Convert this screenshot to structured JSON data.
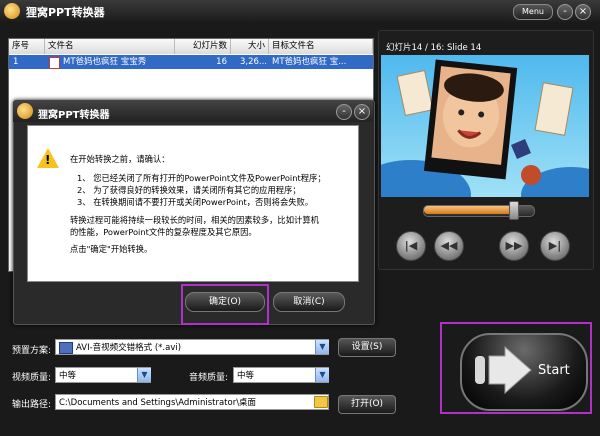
{
  "window": {
    "title": "狸窝PPT转换器",
    "menu_label": "Menu",
    "minimize": "-",
    "close": "×"
  },
  "list": {
    "headers": [
      "序号",
      "文件名",
      "幻灯片数",
      "大小",
      "目标文件名"
    ],
    "rows": [
      {
        "index": "1",
        "filename": "MT爸妈也疯狂 宝宝秀",
        "slides": "16",
        "size": "3,26...",
        "target": "MT爸妈也疯狂 宝..."
      }
    ]
  },
  "preview": {
    "label": "幻灯片14 / 16: Slide 14",
    "progress": 0.82
  },
  "dialog": {
    "title": "狸窝PPT转换器",
    "intro": "在开始转换之前，请确认：",
    "items": [
      "1、  您已经关闭了所有打开的PowerPoint文件及PowerPoint程序；",
      "2、  为了获得良好的转换效果，请关闭所有其它的应用程序；",
      "3、  在转换期间请不要打开或关闭PowerPoint，否则将会失败。"
    ],
    "note_line1": "转换过程可能将持续一段较长的时间，相关的因素较多，比如计算机",
    "note_line2": "的性能，PowerPoint文件的复杂程度及其它原因。",
    "prompt": "点击\"确定\"开始转换。",
    "ok_label": "确定(O)",
    "cancel_label": "取消(C)"
  },
  "settings": {
    "preset_label": "预置方案:",
    "preset_value": "AVI-音视频交错格式 (*.avi)",
    "settings_button": "设置(S)",
    "video_quality_label": "视频质量:",
    "video_quality_value": "中等",
    "audio_quality_label": "音频质量:",
    "audio_quality_value": "中等",
    "output_label": "输出路径:",
    "output_path": "C:\\Documents and Settings\\Administrator\\桌面",
    "open_button": "打开(O)"
  },
  "start": {
    "label": "Start"
  },
  "colors": {
    "selection": "#3169c6",
    "highlight": "#b030c8",
    "accent": "#e08a28"
  }
}
